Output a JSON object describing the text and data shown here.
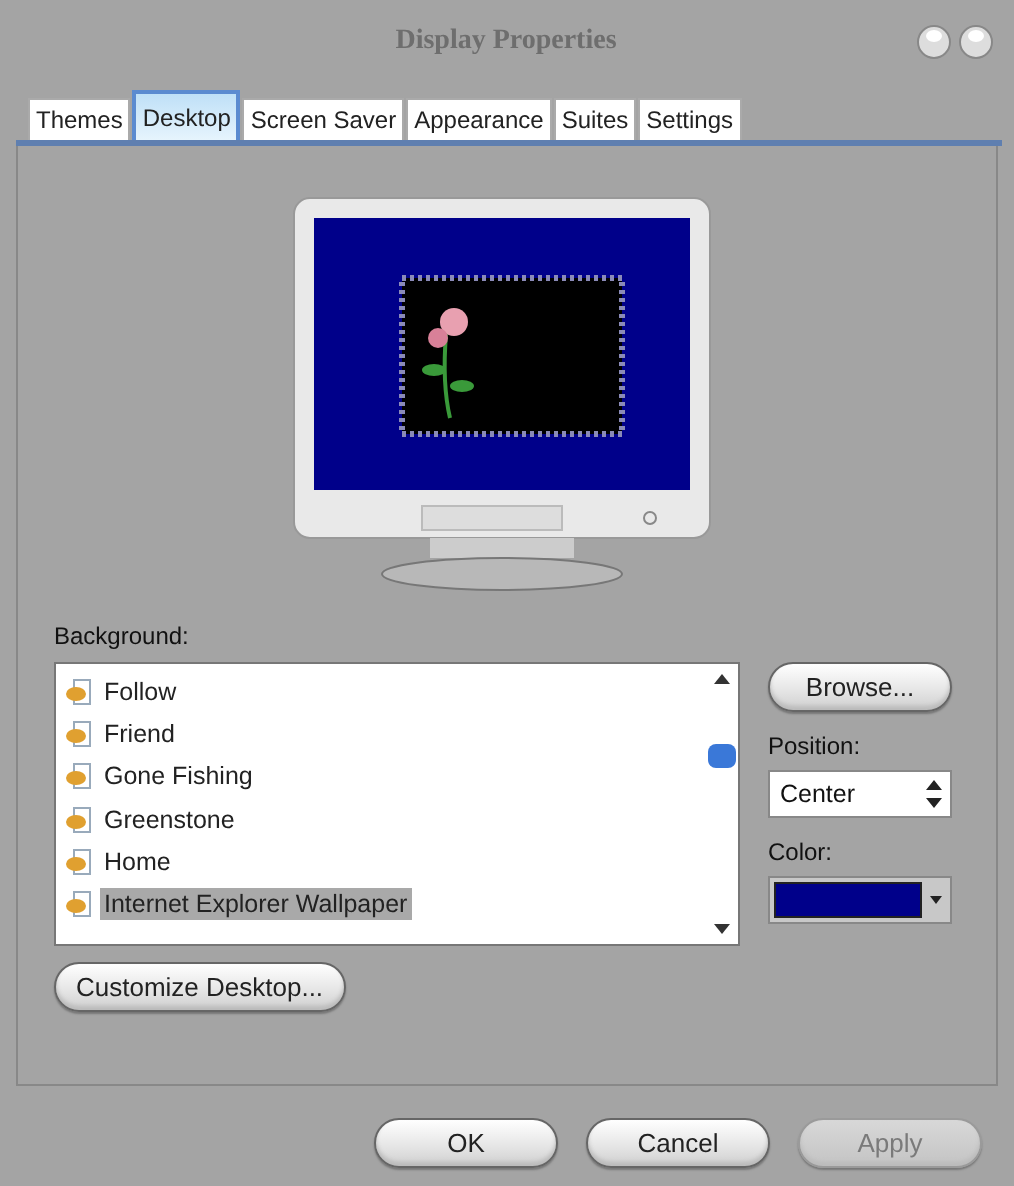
{
  "window": {
    "title": "Display Properties"
  },
  "tabs": [
    {
      "label": "Themes",
      "selected": false
    },
    {
      "label": "Desktop",
      "selected": true
    },
    {
      "label": "Screen Saver",
      "selected": false
    },
    {
      "label": "Appearance",
      "selected": false
    },
    {
      "label": "Suites",
      "selected": false
    },
    {
      "label": "Settings",
      "selected": false
    }
  ],
  "background": {
    "label": "Background:",
    "items": [
      {
        "label": "Follow",
        "selected": false
      },
      {
        "label": "Friend",
        "selected": false
      },
      {
        "label": "Gone Fishing",
        "selected": false
      },
      {
        "label": "Greenstone",
        "selected": false
      },
      {
        "label": "Home",
        "selected": false
      },
      {
        "label": "Internet Explorer Wallpaper",
        "selected": true
      }
    ]
  },
  "browse_button": "Browse...",
  "position": {
    "label": "Position:",
    "value": "Center"
  },
  "color": {
    "label": "Color:"
  },
  "customize_button": "Customize Desktop...",
  "buttons": [
    {
      "label": "OK",
      "disabled": false
    },
    {
      "label": "Cancel",
      "disabled": false
    },
    {
      "label": "Apply",
      "disabled": true
    }
  ]
}
